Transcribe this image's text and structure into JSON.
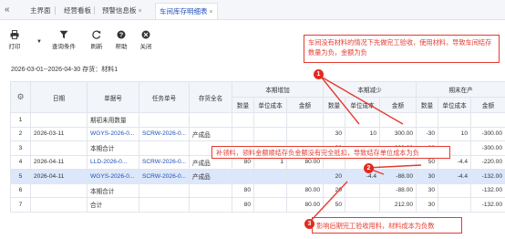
{
  "tabs": {
    "collapse_glyph": "«",
    "items": [
      {
        "label": "主界面",
        "closable": false,
        "active": false
      },
      {
        "label": "经营看板",
        "closable": false,
        "active": false
      },
      {
        "label": "预警信息板",
        "closable": true,
        "active": false
      },
      {
        "label": "车间库存明细表",
        "closable": true,
        "active": true
      }
    ],
    "close_glyph": "×"
  },
  "toolbar": {
    "print_label": "打印",
    "query_label": "查询条件",
    "refresh_label": "刷新",
    "help_label": "帮助",
    "close_label": "关闭"
  },
  "filter": {
    "text": "2026-03-01--2026-04-30  存货：材料1"
  },
  "table": {
    "headers": {
      "date": "日期",
      "doc_no": "单据号",
      "task_no": "任务单号",
      "item_name": "存货全名",
      "group_in": "本期增加",
      "group_out": "本期减少",
      "group_end": "期末在产",
      "qty": "数量",
      "unit_cost": "单位成本",
      "amount": "金额"
    },
    "rows": [
      {
        "idx": "1",
        "date": "",
        "doc": "期初未用数量",
        "task": "",
        "item": "",
        "in_q": "",
        "in_u": "",
        "in_a": "",
        "out_q": "",
        "out_u": "",
        "out_a": "",
        "end_q": "",
        "end_u": "",
        "end_a": "",
        "doc_link": false
      },
      {
        "idx": "2",
        "date": "2026-03-11",
        "doc": "WGYS-2026-0...",
        "task": "SCRW-2026-0...",
        "item": "产成品",
        "in_q": "",
        "in_u": "",
        "in_a": "",
        "out_q": "30",
        "out_u": "10",
        "out_a": "300.00",
        "end_q": "-30",
        "end_u": "10",
        "end_a": "-300.00",
        "doc_link": true
      },
      {
        "idx": "3",
        "date": "",
        "doc": "本期合计",
        "task": "",
        "item": "",
        "in_q": "",
        "in_u": "",
        "in_a": "",
        "out_q": "30",
        "out_u": "",
        "out_a": "300.00",
        "end_q": "-30",
        "end_u": "",
        "end_a": "-300.00",
        "doc_link": false
      },
      {
        "idx": "4",
        "date": "2026-04-11",
        "doc": "LLD-2026-0...",
        "task": "SCRW-2026-0...",
        "item": "产成品",
        "in_q": "80",
        "in_u": "1",
        "in_a": "80.00",
        "out_q": "",
        "out_u": "",
        "out_a": "",
        "end_q": "50",
        "end_u": "-4.4",
        "end_a": "-220.00",
        "doc_link": true
      },
      {
        "idx": "5",
        "date": "2026-04-11",
        "doc": "WGYS-2026-0...",
        "task": "SCRW-2026-0...",
        "item": "产成品",
        "in_q": "",
        "in_u": "",
        "in_a": "",
        "out_q": "20",
        "out_u": "-4.4",
        "out_a": "-88.00",
        "end_q": "30",
        "end_u": "-4.4",
        "end_a": "-132.00",
        "doc_link": true
      },
      {
        "idx": "6",
        "date": "",
        "doc": "本期合计",
        "task": "",
        "item": "",
        "in_q": "80",
        "in_u": "",
        "in_a": "80.00",
        "out_q": "20",
        "out_u": "",
        "out_a": "-88.00",
        "end_q": "30",
        "end_u": "",
        "end_a": "-132.00",
        "doc_link": false
      },
      {
        "idx": "7",
        "date": "",
        "doc": "合计",
        "task": "",
        "item": "",
        "in_q": "80",
        "in_u": "",
        "in_a": "80.00",
        "out_q": "50",
        "out_u": "",
        "out_a": "212.00",
        "end_q": "30",
        "end_u": "",
        "end_a": "-132.00",
        "doc_link": false
      }
    ],
    "selected_row_index": 4
  },
  "annotations": [
    {
      "badge": "1",
      "text": "车间没有材料的情况下先做完工验收，使用材料，导致车间结存数量为负，金额为负"
    },
    {
      "badge": "2",
      "text": "补领料，领料金额顺结存负金额没有完全抵扣，导致结存单位成本为负"
    },
    {
      "badge": "3",
      "text": "影响后期完工验收用料，材料成本为负数"
    }
  ],
  "colors": {
    "accent": "#1e4fb8",
    "annotation": "#e53b30",
    "selected_row": "#dde7fb"
  }
}
